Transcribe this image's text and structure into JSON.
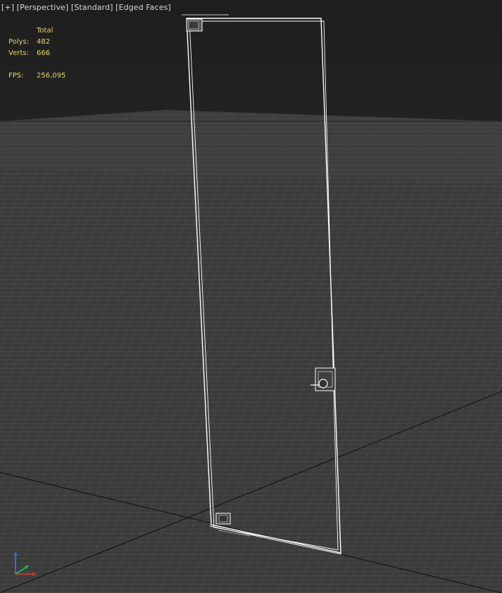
{
  "viewport": {
    "labels": {
      "plus": "[+]",
      "view": "[Perspective]",
      "shading": "[Standard]",
      "edged": "[Edged Faces]"
    }
  },
  "stats": {
    "header": "Total",
    "polys_label": "Polys:",
    "polys_value": "482",
    "verts_label": "Verts:",
    "verts_value": "666",
    "fps_label": "FPS:",
    "fps_value": "256,095"
  },
  "colors": {
    "background": "#1f1f1f",
    "grid_floor": "#3a3a3a",
    "grid_line": "#5a5a5a",
    "wireframe": "#ffffff",
    "stats_text": "#e6d36a",
    "label_text": "#d7d7d7",
    "axis_x": "#c0392b",
    "axis_y": "#27ae60",
    "axis_z": "#2e6fd4"
  },
  "icons": {
    "gizmo": "axis-gizmo-icon",
    "hinge_top": "hinge-icon",
    "hinge_bottom": "hinge-icon",
    "handle": "door-handle-icon"
  }
}
